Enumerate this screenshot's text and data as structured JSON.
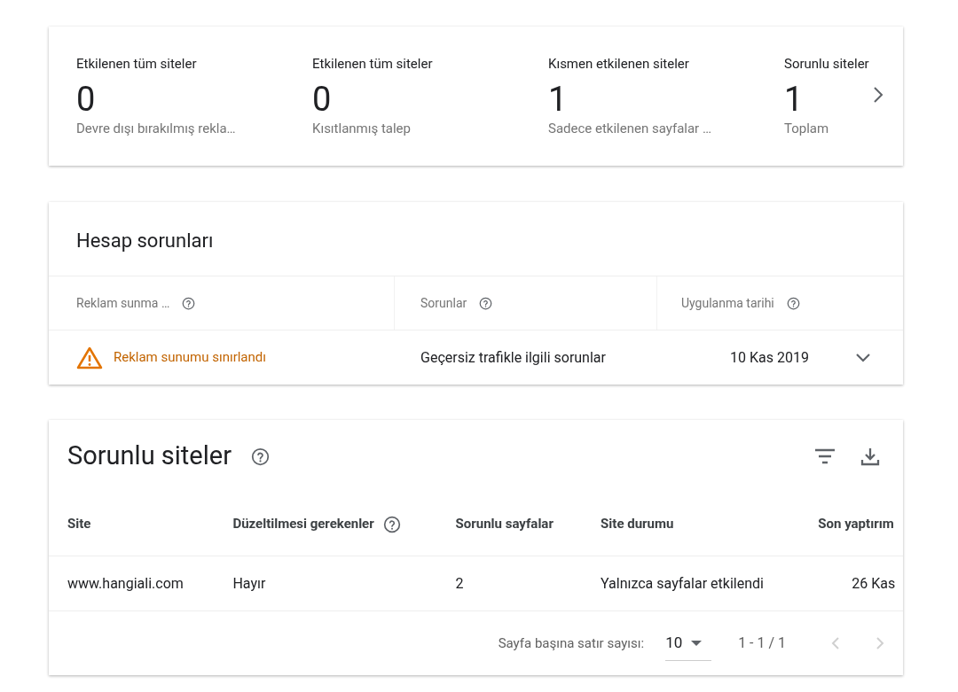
{
  "summary": {
    "items": [
      {
        "title": "Etkilenen tüm siteler",
        "value": "0",
        "caption": "Devre dışı bırakılmış rekla…"
      },
      {
        "title": "Etkilenen tüm siteler",
        "value": "0",
        "caption": "Kısıtlanmış talep"
      },
      {
        "title": "Kısmen etkilenen siteler",
        "value": "1",
        "caption": "Sadece etkilenen sayfalar …"
      },
      {
        "title": "Sorunlu siteler",
        "value": "1",
        "caption": "Toplam"
      }
    ]
  },
  "account_issues": {
    "title": "Hesap sorunları",
    "columns": [
      {
        "label": "Reklam sunma …",
        "help": true
      },
      {
        "label": "Sorunlar",
        "help": true
      },
      {
        "label": "Uygulanma tarihi",
        "help": true
      }
    ],
    "rows": [
      {
        "status": "Reklam sunumu sınırlandı",
        "kind": "warning",
        "issue": "Geçersiz trafikle ilgili sorunlar",
        "date": "10 Kas 2019",
        "expanded": false
      }
    ]
  },
  "sites": {
    "title": "Sorunlu siteler",
    "columns": [
      {
        "label": "Site",
        "help": false
      },
      {
        "label": "Düzeltilmesi gerekenler",
        "help": true
      },
      {
        "label": "Sorunlu sayfalar",
        "help": false
      },
      {
        "label": "Site durumu",
        "help": false
      },
      {
        "label": "Son yaptırım",
        "help": false
      }
    ],
    "rows": [
      {
        "cells": [
          "www.hangiali.com",
          "Hayır",
          "2",
          "Yalnızca sayfalar etkilendi",
          "26 Kas"
        ]
      }
    ],
    "pagination": {
      "rows_label": "Sayfa başına satır sayısı:",
      "rows_per_page": "10",
      "range": "1 - 1 / 1",
      "prev_disabled": true,
      "next_disabled": true
    }
  }
}
